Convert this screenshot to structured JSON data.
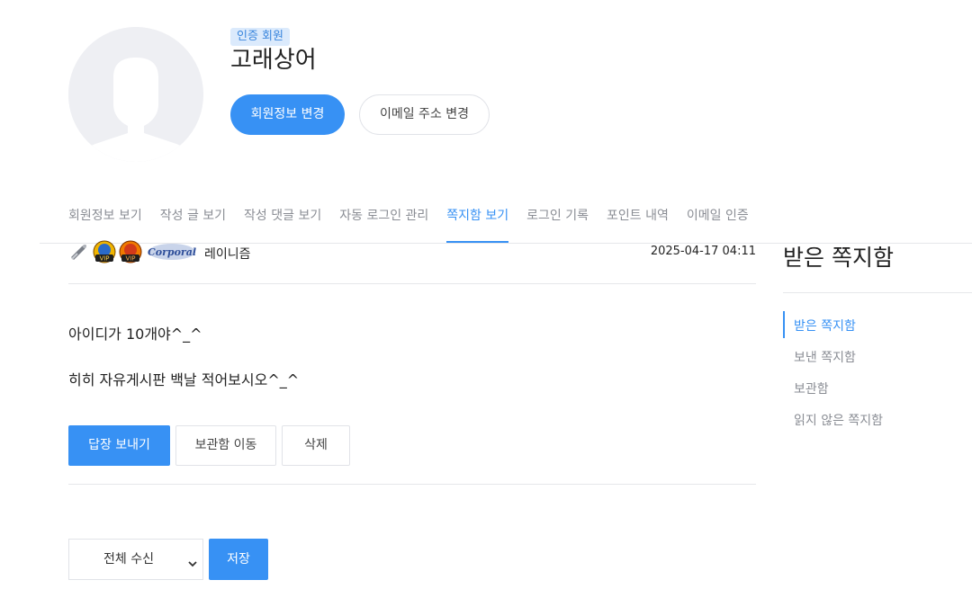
{
  "profile": {
    "badge": "인증 회원",
    "username": "고래상어",
    "edit_info_label": "회원정보 변경",
    "change_email_label": "이메일 주소 변경"
  },
  "tabs": [
    {
      "label": "회원정보 보기",
      "active": false
    },
    {
      "label": "작성 글 보기",
      "active": false
    },
    {
      "label": "작성 댓글 보기",
      "active": false
    },
    {
      "label": "자동 로그인 관리",
      "active": false
    },
    {
      "label": "쪽지함 보기",
      "active": true
    },
    {
      "label": "로그인 기록",
      "active": false
    },
    {
      "label": "포인트 내역",
      "active": false
    },
    {
      "label": "이메일 인증",
      "active": false
    }
  ],
  "message": {
    "sender_badges": [
      "tool-icon",
      "vip-icon",
      "vip-icon",
      "corporal-rank-icon"
    ],
    "rank_text": "Corporal",
    "vip_text": "VIP",
    "sender_name": "레이니즘",
    "date": "2025-04-17 04:11",
    "body": [
      "아이디가 10개야^_^",
      "히히 자유게시판 백날 적어보시오^_^"
    ],
    "reply_label": "답장 보내기",
    "archive_label": "보관함 이동",
    "delete_label": "삭제"
  },
  "settings": {
    "receive_option": "전체 수신",
    "save_label": "저장"
  },
  "sidebar": {
    "title": "받은 쪽지함",
    "items": [
      {
        "label": "받은 쪽지함",
        "active": true
      },
      {
        "label": "보낸 쪽지함",
        "active": false
      },
      {
        "label": "보관함",
        "active": false
      },
      {
        "label": "읽지 않은 쪽지함",
        "active": false
      }
    ]
  },
  "colors": {
    "accent": "#3791f4",
    "muted": "#8a8d94",
    "border": "#e1e3e8",
    "badge_bg": "#dbeafc"
  }
}
